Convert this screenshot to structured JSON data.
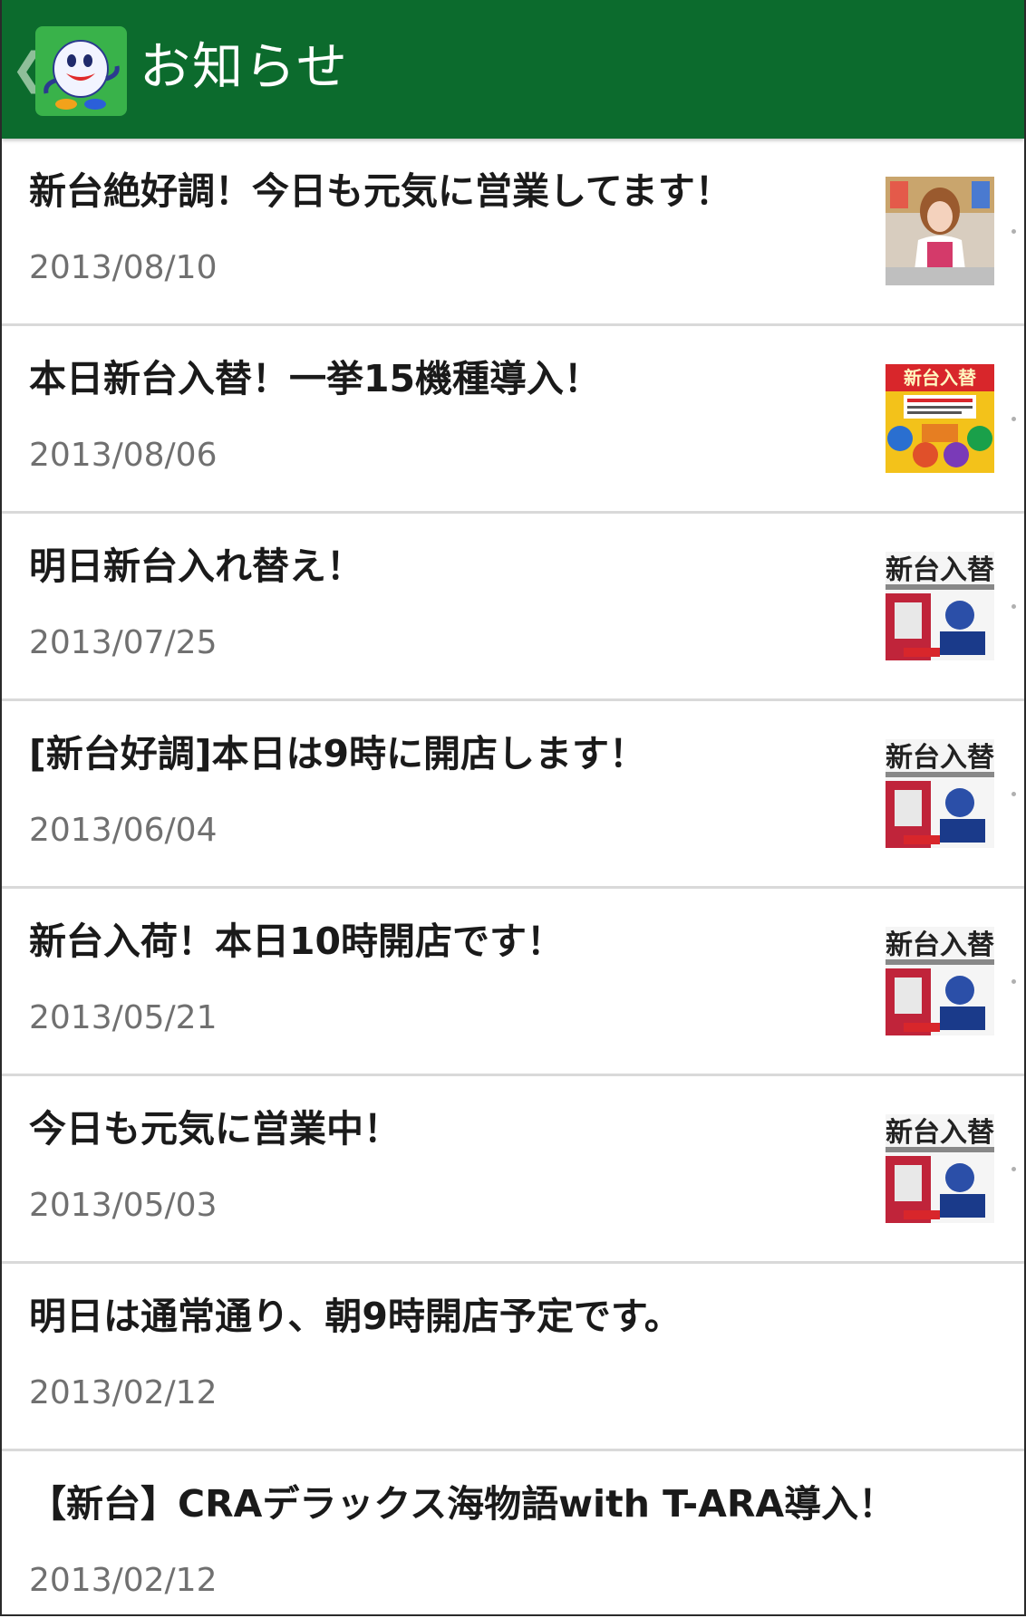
{
  "header": {
    "title": "お知らせ",
    "back_icon": "chevron-left-icon",
    "app_icon": "mascot-app-icon",
    "background": "#0c6b2d"
  },
  "news": [
    {
      "title": "新台絶好調！今日も元気に営業してます！",
      "date": "2013/08/10",
      "thumb": "photo-thumbnail"
    },
    {
      "title": "本日新台入替！一挙15機種導入！",
      "date": "2013/08/06",
      "thumb": "flyer-thumbnail"
    },
    {
      "title": "明日新台入れ替え！",
      "date": "2013/07/25",
      "thumb": "poster-thumbnail"
    },
    {
      "title": "[新台好調]本日は9時に開店します！",
      "date": "2013/06/04",
      "thumb": "poster-thumbnail"
    },
    {
      "title": "新台入荷！本日10時開店です！",
      "date": "2013/05/21",
      "thumb": "poster-thumbnail"
    },
    {
      "title": "今日も元気に営業中！",
      "date": "2013/05/03",
      "thumb": "poster-thumbnail"
    },
    {
      "title": "明日は通常通り、朝9時開店予定です。",
      "date": "2013/02/12",
      "thumb": null
    },
    {
      "title": "【新台】CRAデラックス海物語with T-ARA導入！",
      "date": "2013/02/12",
      "thumb": null
    }
  ],
  "thumb_texts": {
    "flyer_heading": "新台入替",
    "poster_heading": "新台入替"
  }
}
